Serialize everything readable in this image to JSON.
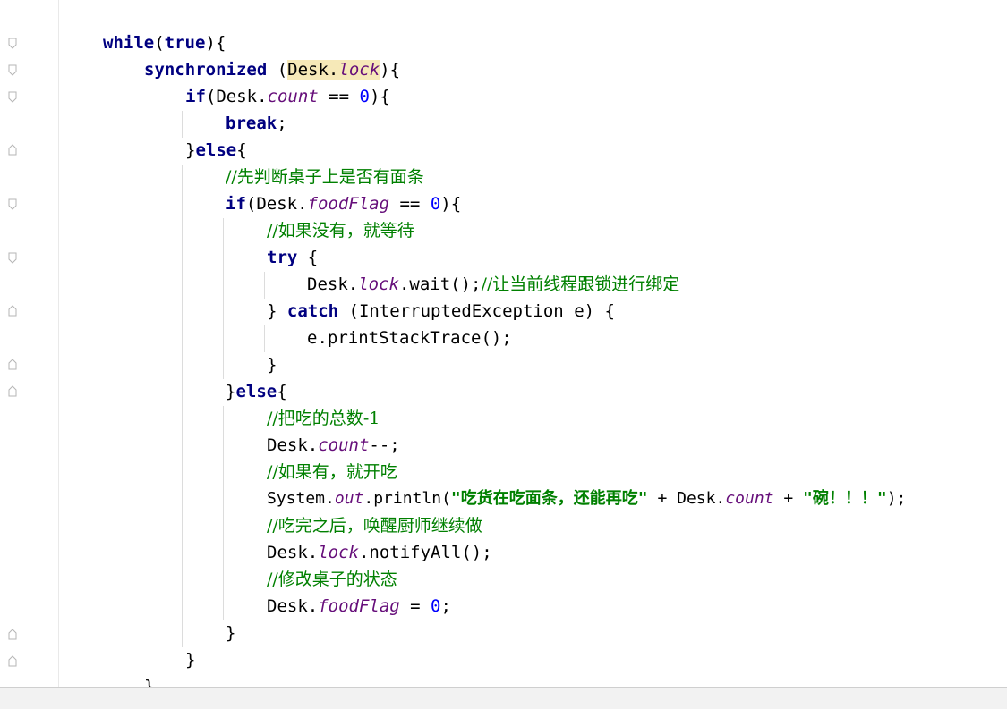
{
  "editor": {
    "lines": [
      {
        "id": "l1",
        "tokens": [
          {
            "t": "while",
            "c": "kw"
          },
          {
            "t": "(",
            "c": ""
          },
          {
            "t": "true",
            "c": "kw"
          },
          {
            "t": "){",
            "c": ""
          }
        ]
      },
      {
        "id": "l2",
        "tokens": [
          {
            "t": "synchronized",
            "c": "kw"
          },
          {
            "t": " (",
            "c": ""
          },
          {
            "t": "Desk.",
            "c": "hl"
          },
          {
            "t": "lock",
            "c": "hl field"
          },
          {
            "t": "){",
            "c": ""
          }
        ]
      },
      {
        "id": "l3",
        "tokens": [
          {
            "t": "if",
            "c": "kw"
          },
          {
            "t": "(Desk.",
            "c": ""
          },
          {
            "t": "count",
            "c": "field"
          },
          {
            "t": " == ",
            "c": ""
          },
          {
            "t": "0",
            "c": "num"
          },
          {
            "t": "){",
            "c": ""
          }
        ]
      },
      {
        "id": "l4",
        "tokens": [
          {
            "t": "break",
            "c": "kw"
          },
          {
            "t": ";",
            "c": ""
          }
        ]
      },
      {
        "id": "l5",
        "tokens": [
          {
            "t": "}",
            "c": ""
          },
          {
            "t": "else",
            "c": "kw"
          },
          {
            "t": "{",
            "c": ""
          }
        ]
      },
      {
        "id": "l6",
        "tokens": [
          {
            "t": "//先判断桌子上是否有面条",
            "c": "comment"
          }
        ]
      },
      {
        "id": "l7",
        "tokens": [
          {
            "t": "if",
            "c": "kw"
          },
          {
            "t": "(Desk.",
            "c": ""
          },
          {
            "t": "foodFlag",
            "c": "field"
          },
          {
            "t": " == ",
            "c": ""
          },
          {
            "t": "0",
            "c": "num"
          },
          {
            "t": "){",
            "c": ""
          }
        ]
      },
      {
        "id": "l8",
        "tokens": [
          {
            "t": "//如果没有，就等待",
            "c": "comment"
          }
        ]
      },
      {
        "id": "l9",
        "tokens": [
          {
            "t": "try",
            "c": "kw"
          },
          {
            "t": " {",
            "c": ""
          }
        ]
      },
      {
        "id": "l10",
        "tokens": [
          {
            "t": "Desk.",
            "c": ""
          },
          {
            "t": "lock",
            "c": "field"
          },
          {
            "t": ".wait();",
            "c": ""
          },
          {
            "t": "//让当前线程跟锁进行绑定",
            "c": "comment"
          }
        ]
      },
      {
        "id": "l11",
        "tokens": [
          {
            "t": "} ",
            "c": ""
          },
          {
            "t": "catch",
            "c": "kw"
          },
          {
            "t": " (InterruptedException e) {",
            "c": ""
          }
        ]
      },
      {
        "id": "l12",
        "tokens": [
          {
            "t": "e.printStackTrace();",
            "c": ""
          }
        ]
      },
      {
        "id": "l13",
        "tokens": [
          {
            "t": "}",
            "c": ""
          }
        ]
      },
      {
        "id": "l14",
        "tokens": [
          {
            "t": "}",
            "c": ""
          },
          {
            "t": "else",
            "c": "kw"
          },
          {
            "t": "{",
            "c": ""
          }
        ]
      },
      {
        "id": "l15",
        "tokens": [
          {
            "t": "//把吃的总数",
            "c": "comment"
          },
          {
            "t": "-1",
            "c": "comment"
          }
        ]
      },
      {
        "id": "l16",
        "tokens": [
          {
            "t": "Desk.",
            "c": ""
          },
          {
            "t": "count",
            "c": "field"
          },
          {
            "t": "--;",
            "c": ""
          }
        ]
      },
      {
        "id": "l17",
        "tokens": [
          {
            "t": "//如果有，就开吃",
            "c": "comment"
          }
        ]
      },
      {
        "id": "l18",
        "tokens": [
          {
            "t": "System.",
            "c": ""
          },
          {
            "t": "out",
            "c": "field"
          },
          {
            "t": ".println(",
            "c": ""
          },
          {
            "t": "\"吃货在吃面条，还能再吃\"",
            "c": "str"
          },
          {
            "t": " + Desk.",
            "c": ""
          },
          {
            "t": "count",
            "c": "field"
          },
          {
            "t": " + ",
            "c": ""
          },
          {
            "t": "\"碗！！！\"",
            "c": "str"
          },
          {
            "t": ");",
            "c": ""
          }
        ]
      },
      {
        "id": "l19",
        "tokens": [
          {
            "t": "//吃完之后，唤醒厨师继续做",
            "c": "comment"
          }
        ]
      },
      {
        "id": "l20",
        "tokens": [
          {
            "t": "Desk.",
            "c": ""
          },
          {
            "t": "lock",
            "c": "field"
          },
          {
            "t": ".notifyAll();",
            "c": ""
          }
        ]
      },
      {
        "id": "l21",
        "tokens": [
          {
            "t": "//修改桌子的状态",
            "c": "comment"
          }
        ]
      },
      {
        "id": "l22",
        "tokens": [
          {
            "t": "Desk.",
            "c": ""
          },
          {
            "t": "foodFlag",
            "c": "field"
          },
          {
            "t": " = ",
            "c": ""
          },
          {
            "t": "0",
            "c": "num"
          },
          {
            "t": ";",
            "c": ""
          }
        ]
      },
      {
        "id": "l23",
        "tokens": [
          {
            "t": "}",
            "c": ""
          }
        ]
      },
      {
        "id": "l24",
        "tokens": [
          {
            "t": "}",
            "c": ""
          }
        ]
      },
      {
        "id": "l25",
        "tokens": [
          {
            "t": "}",
            "c": ""
          }
        ]
      }
    ],
    "colors": {
      "keyword": "#000080",
      "field": "#660e7a",
      "number": "#0000ff",
      "string": "#008000",
      "comment": "#008000",
      "highlight": "#f6e9b8"
    }
  }
}
